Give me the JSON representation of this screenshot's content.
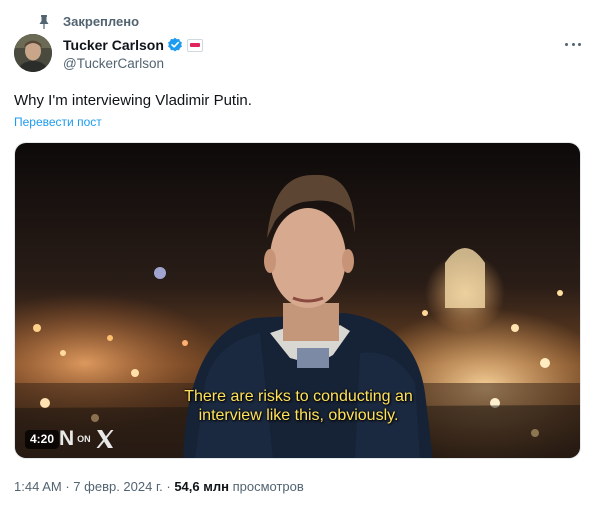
{
  "pinned": {
    "label": "Закреплено",
    "icon": "pin-icon"
  },
  "author": {
    "name": "Tucker Carlson",
    "handle": "@TuckerCarlson",
    "verified_color": "#1d9bf0",
    "affiliate_badge_color": "#e0245e"
  },
  "tweet": {
    "text": "Why I'm interviewing Vladimir Putin.",
    "translate_label": "Перевести пост"
  },
  "video": {
    "subtitle_line1": "There are risks to conducting an",
    "subtitle_line2": "interview like this, obviously.",
    "duration": "4:20",
    "watermark_n": "N",
    "watermark_on": "ON",
    "subtitle_color": "#ffe15a"
  },
  "meta": {
    "time": "1:44 AM",
    "sep": "·",
    "date": "7 февр. 2024 г.",
    "views_count": "54,6 млн",
    "views_label": "просмотров"
  }
}
